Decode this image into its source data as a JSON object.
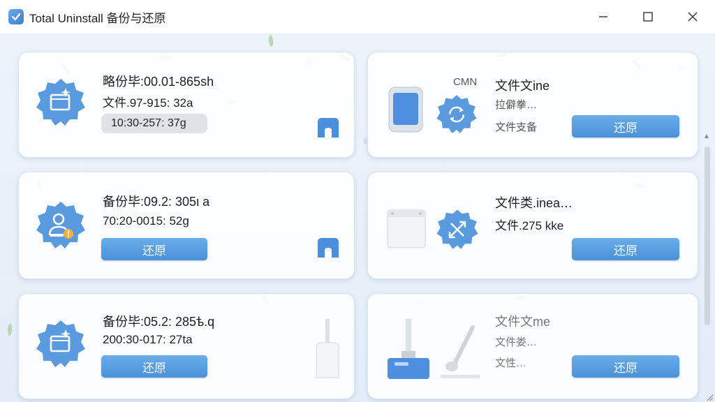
{
  "window": {
    "title": "Total Uninstall 备份与还原",
    "minimize_glyph": "—",
    "close_glyph": "✕"
  },
  "cards": [
    {
      "line1": "略份毕:00.01-865sh",
      "line2": "文件.97-915: 32a",
      "pill": "10:30-257: 37g",
      "badge_icon": "folder-icon"
    },
    {
      "label_top": "CMN",
      "line1": "文件文ine",
      "line2": "拉僻拳…",
      "line3": "文件支备",
      "button": "还原",
      "badge_icon": "refresh-arrows-icon"
    },
    {
      "line1": "备份毕:09.2: 305ι a",
      "line2": "70:20-0015: 52g",
      "button": "还原",
      "badge_icon": "user-warning-icon"
    },
    {
      "line1": "文件类.inea…",
      "line2": "文件.275 kke",
      "button": "还原",
      "badge_icon": "expand-arrows-icon"
    },
    {
      "line1": "备份毕:05.2: 285ѣ.q",
      "line2": "200:30-017: 27ta",
      "button": "还原",
      "badge_icon": "folder-icon"
    },
    {
      "line1": "文件文me",
      "line2": "文件娄…",
      "line3": "文性…",
      "button": "还原"
    }
  ],
  "colors": {
    "accent": "#4a91d8",
    "badge": "#5a9be0",
    "leaf": "#a8cf9a"
  }
}
